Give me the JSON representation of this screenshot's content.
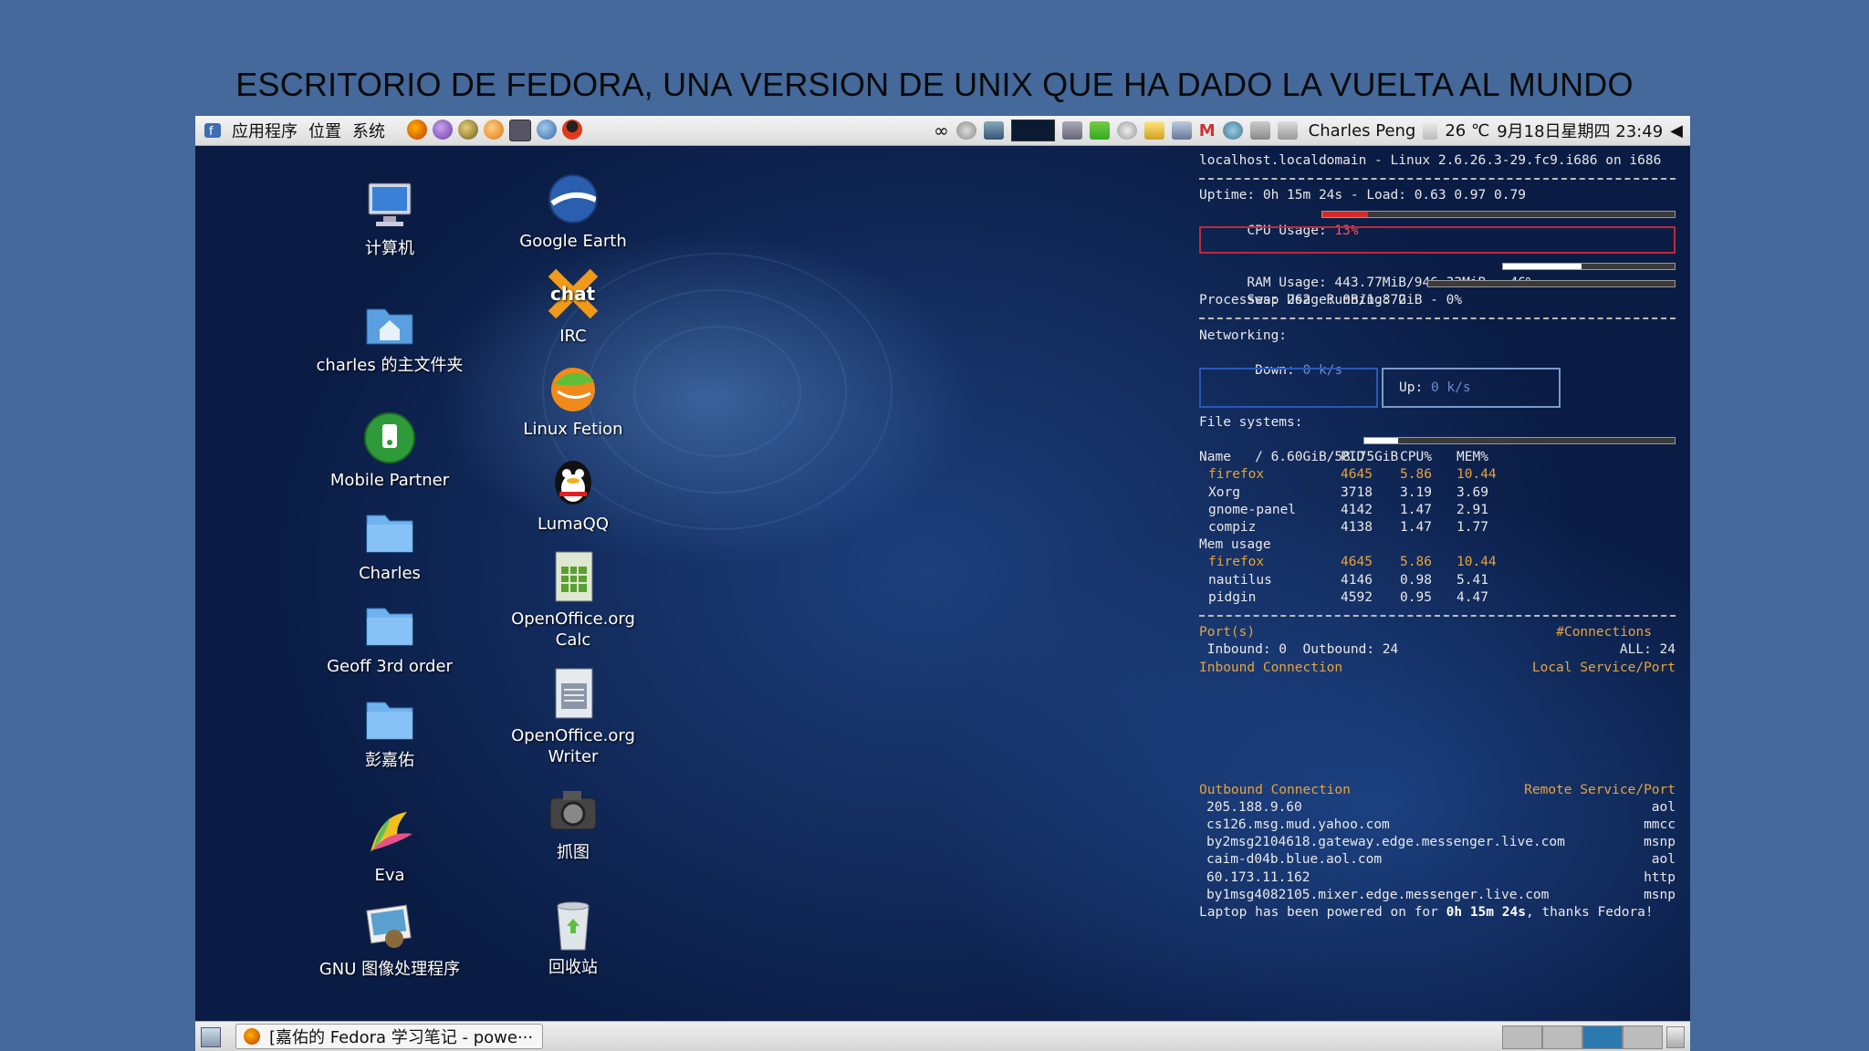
{
  "slide": {
    "title": "ESCRITORIO DE FEDORA, UNA VERSION DE UNIX QUE HA DADO LA VUELTA AL MUNDO"
  },
  "top_panel": {
    "menus": [
      "应用程序",
      "位置",
      "系统"
    ],
    "user": "Charles Peng",
    "temperature": "26 ℃",
    "datetime": "9月18日星期四 23:49"
  },
  "desktop_icons": {
    "col1": [
      {
        "label": "计算机",
        "icon": "computer-icon"
      },
      {
        "label": "charles 的主文件夹",
        "icon": "home-folder-icon"
      },
      {
        "label": "Mobile Partner",
        "icon": "mobile-partner-icon"
      },
      {
        "label": "Charles",
        "icon": "folder-icon"
      },
      {
        "label": "Geoff 3rd order",
        "icon": "folder-icon"
      },
      {
        "label": "彭嘉佑",
        "icon": "folder-icon"
      },
      {
        "label": "Eva",
        "icon": "eva-icon"
      },
      {
        "label": "GNU 图像处理程序",
        "icon": "gimp-icon"
      }
    ],
    "col2": [
      {
        "label": "Google Earth",
        "icon": "google-earth-icon"
      },
      {
        "label": "IRC",
        "icon": "irc-chat-icon"
      },
      {
        "label": "Linux Fetion",
        "icon": "fetion-icon"
      },
      {
        "label": "LumaQQ",
        "icon": "qq-penguin-icon"
      },
      {
        "label": "OpenOffice.org Calc",
        "icon": "spreadsheet-icon"
      },
      {
        "label": "OpenOffice.org Writer",
        "icon": "writer-icon"
      },
      {
        "label": "抓图",
        "icon": "camera-icon"
      },
      {
        "label": "回收站",
        "icon": "trash-icon"
      }
    ]
  },
  "conky": {
    "host": "localhost.localdomain - Linux 2.6.26.3-29.fc9.i686 on i686",
    "uptime": "Uptime: 0h 15m 24s - Load: 0.63 0.97 0.79",
    "cpu_label": "CPU Usage:",
    "cpu_value": "13%",
    "cpu_fraction": 0.13,
    "ram": "RAM Usage: 443.77MiB/946.32MiB - 46%",
    "ram_fraction": 0.46,
    "swap": "Swap Usage: 0B/1.87GiB - 0%",
    "swap_fraction": 0.0,
    "processes": "Processes: 262  Running: 2",
    "networking": "Networking:",
    "down_label": " Down:",
    "down_value": "0 k/s",
    "up_label": "Up:",
    "up_value": "0 k/s",
    "filesystems": "File systems:",
    "fs_root": " / 6.60GiB/58.75GiB",
    "fs_fraction": 0.11,
    "table_headers": [
      "Name",
      "PID",
      "CPU%",
      "MEM%"
    ],
    "cpu_procs": [
      {
        "name": "firefox",
        "pid": "4645",
        "cpu": "5.86",
        "mem": "10.44",
        "highlight": true
      },
      {
        "name": "Xorg",
        "pid": "3718",
        "cpu": "3.19",
        "mem": "3.69",
        "highlight": false
      },
      {
        "name": "gnome-panel",
        "pid": "4142",
        "cpu": "1.47",
        "mem": "2.91",
        "highlight": false
      },
      {
        "name": "compiz",
        "pid": "4138",
        "cpu": "1.47",
        "mem": "1.77",
        "highlight": false
      }
    ],
    "mem_usage_label": "Mem usage",
    "mem_procs": [
      {
        "name": "firefox",
        "pid": "4645",
        "cpu": "5.86",
        "mem": "10.44",
        "highlight": true
      },
      {
        "name": "nautilus",
        "pid": "4146",
        "cpu": "0.98",
        "mem": "5.41",
        "highlight": false
      },
      {
        "name": "pidgin",
        "pid": "4592",
        "cpu": "0.95",
        "mem": "4.47",
        "highlight": false
      }
    ],
    "ports_label": "Port(s)",
    "connections_label": "#Connections",
    "inbound_outbound": " Inbound: 0  Outbound: 24",
    "all_count": "ALL: 24",
    "inbound_conn": "Inbound Connection",
    "local_service": "Local Service/Port",
    "outbound_conn": "Outbound Connection",
    "remote_service": "Remote Service/Port",
    "outbound_list": [
      {
        "host": "205.188.9.60",
        "svc": "aol"
      },
      {
        "host": "cs126.msg.mud.yahoo.com",
        "svc": "mmcc"
      },
      {
        "host": "by2msg2104618.gateway.edge.messenger.live.com",
        "svc": "msnp"
      },
      {
        "host": "caim-d04b.blue.aol.com",
        "svc": "aol"
      },
      {
        "host": "60.173.11.162",
        "svc": "http"
      },
      {
        "host": "by1msg4082105.mixer.edge.messenger.live.com",
        "svc": "msnp"
      }
    ],
    "footer_pre": "Laptop has been powered on for ",
    "footer_time": "0h 15m 24s",
    "footer_post": ", thanks Fedora!"
  },
  "bottom_panel": {
    "task_label": "[嘉佑的 Fedora 学习笔记 - powe···"
  },
  "colors": {
    "accent_orange": "#e7a43b",
    "cpu_red": "#d42a2a",
    "desktop_blue": "#173a78"
  }
}
